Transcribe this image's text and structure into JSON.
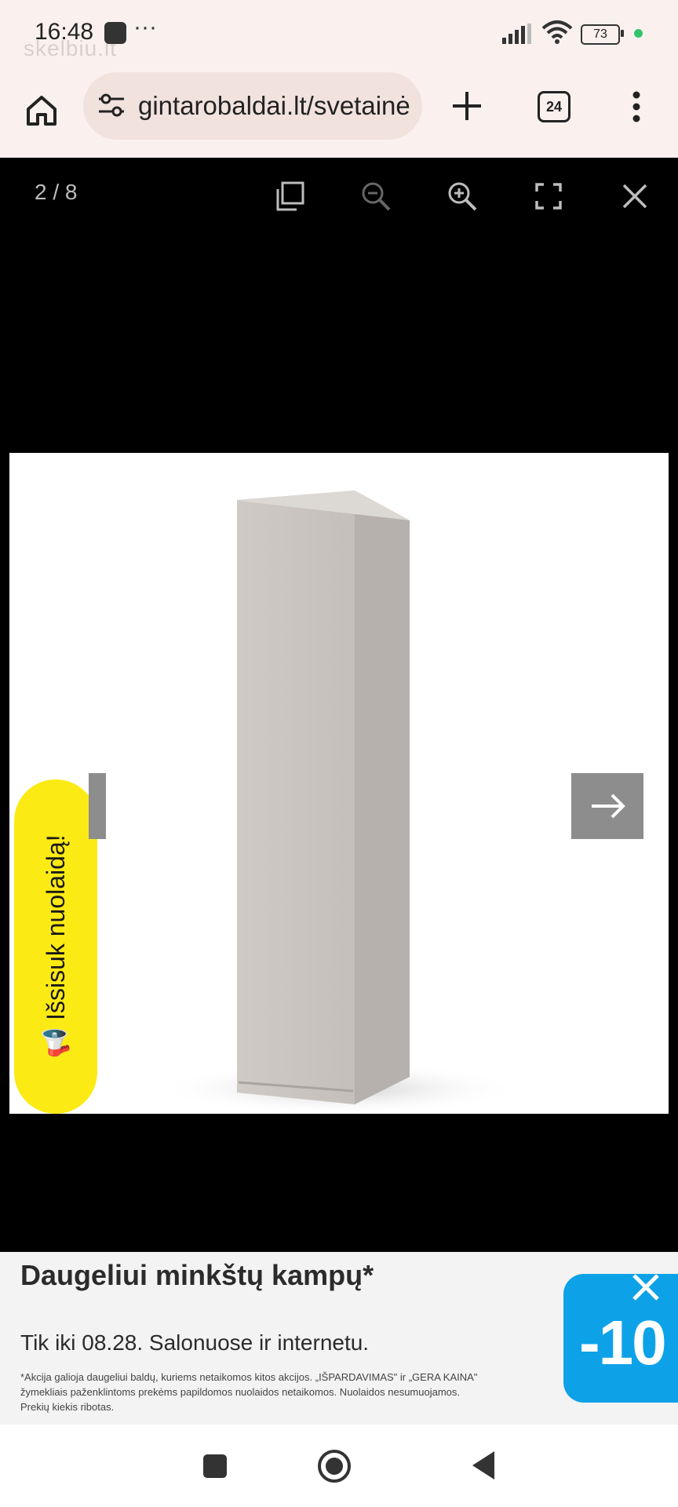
{
  "status_bar": {
    "time": "16:48",
    "more": "···",
    "watermark": "skelbiu.lt",
    "battery": "73",
    "icons": [
      "notification-icon",
      "signal-icon",
      "wifi-icon",
      "battery-icon"
    ]
  },
  "browser": {
    "url": "gintarobaldai.lt/svetainė",
    "tab_count": "24",
    "icons": [
      "home-icon",
      "site-settings-icon",
      "new-tab-icon",
      "tabs-icon",
      "menu-icon"
    ]
  },
  "viewer": {
    "counter": "2 / 8",
    "toolbar_icons": [
      "copy-icon",
      "zoom-out-icon",
      "zoom-in-icon",
      "fullscreen-icon",
      "close-icon"
    ]
  },
  "promo": {
    "label": "Išsisuk nuolaidą!",
    "emoji": "📢"
  },
  "ad": {
    "title": "Daugeliui minkštų kampų*",
    "subtitle": "Tik iki 08.28. Salonuose ir internetu.",
    "fine_print": "*Akcija galioja daugeliui baldų, kuriems netaikomos kitos akcijos. „IŠPARDAVIMAS\" ir „GERA KAINA\" žymekliais paženklintoms prekėms papildomos nuolaidos netaikomos. Nuolaidos nesumuojamos. Prekių kiekis ribotas.",
    "badge": "-10",
    "badge_color": "#0da2e8"
  },
  "colors": {
    "promo_yellow": "#fcea14",
    "chrome_bg": "#faf1ef"
  }
}
